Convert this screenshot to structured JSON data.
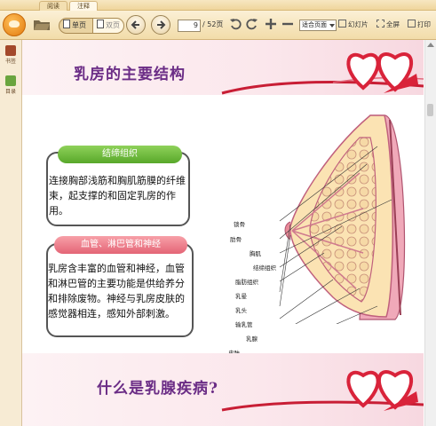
{
  "tabs": [
    "阅读",
    "注释"
  ],
  "toolbar": {
    "view_single": "单页",
    "view_double": "双页",
    "page_current": "9",
    "page_total": "/ 52页",
    "zoom_value": "适合页面",
    "slideshow": "幻灯片",
    "fullscreen": "全屏",
    "print": "打印"
  },
  "sidebar": {
    "bookmark": "书签",
    "toc": "目录"
  },
  "page": {
    "section1_title": "乳房的主要结构",
    "card1": {
      "title": "结缔组织",
      "text": "连接胸部浅筋和胸肌筋膜的纤维束，起支撑的和固定乳房的作用。"
    },
    "card2": {
      "title": "血管、淋巴管和神经",
      "text": "乳房含丰富的血管和神经，血管和淋巴管的主要功能是供给养分和排除废物。神经与乳房皮肤的感觉器相连，感知外部刺激。"
    },
    "diagram_labels": [
      "锁骨",
      "肋骨",
      "胸肌",
      "结缔组织",
      "脂肪组织",
      "乳晕",
      "乳头",
      "输乳管",
      "乳腺",
      "皮肤"
    ],
    "section2_title": "什么是乳腺疾病?"
  },
  "colors": {
    "accent_title": "#6b2d86",
    "green_tag": "#6cbb3c",
    "pink_tag": "#ee7f8b",
    "heart": "#d9233a"
  }
}
